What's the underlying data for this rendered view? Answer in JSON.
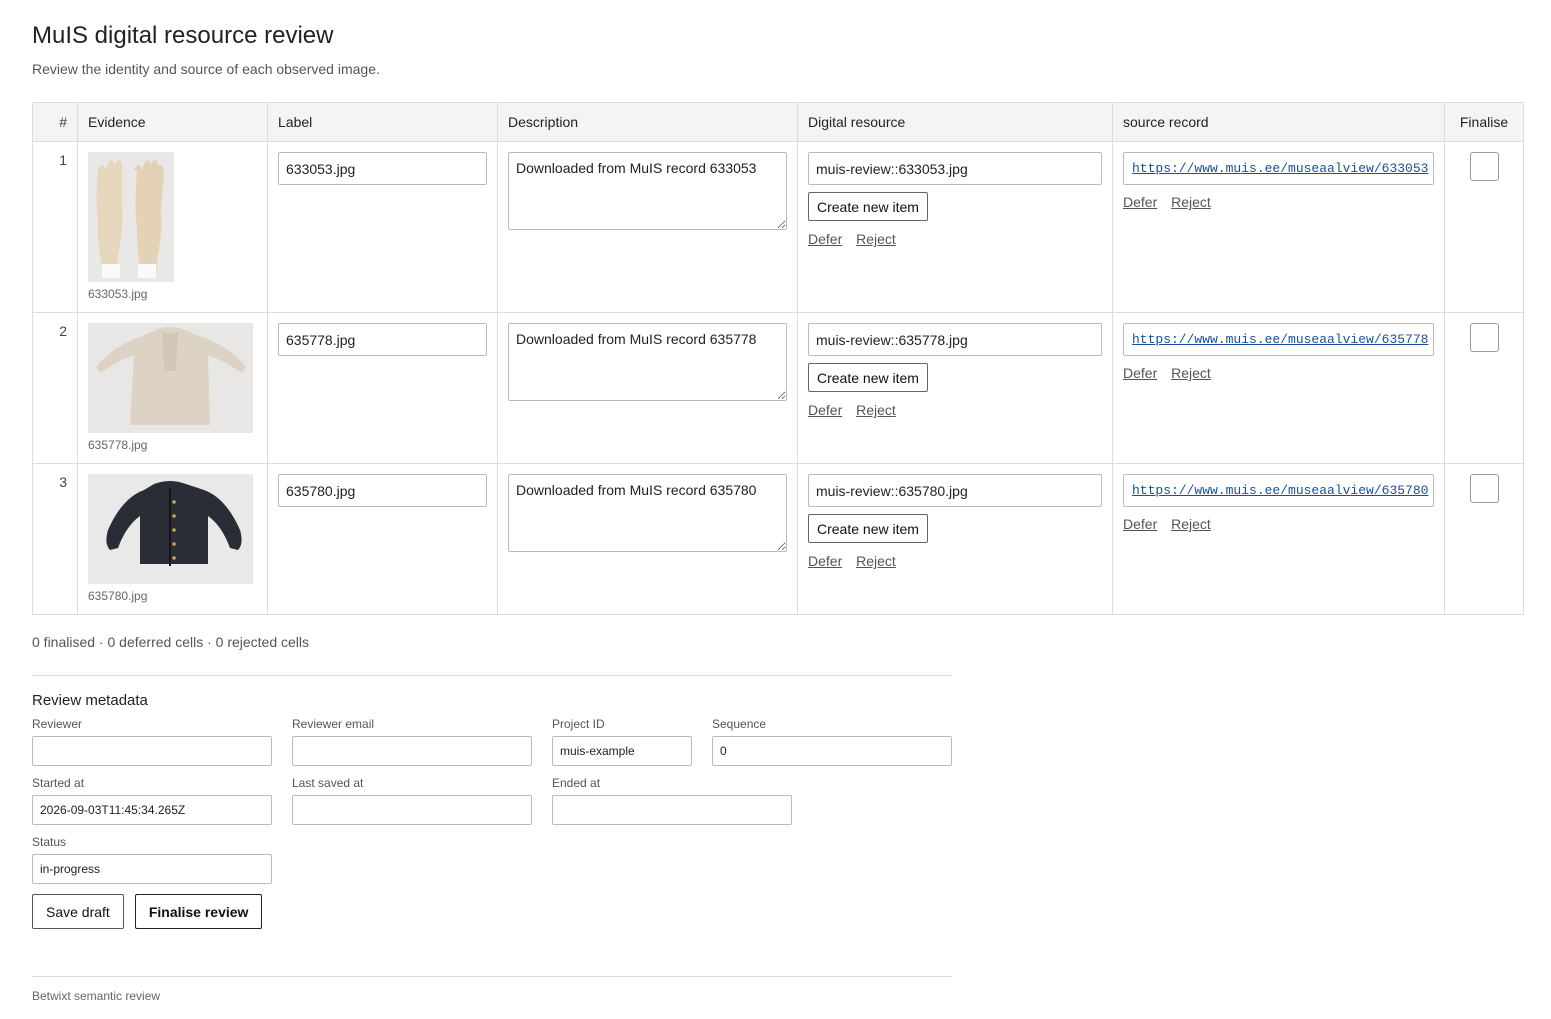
{
  "page": {
    "title": "MuIS digital resource review",
    "subtitle": "Review the identity and source of each observed image."
  },
  "table": {
    "headers": {
      "num": "#",
      "evidence": "Evidence",
      "label": "Label",
      "description": "Description",
      "digital_resource": "Digital resource",
      "source_record": "source record",
      "finalise": "Finalise"
    },
    "rows": [
      {
        "num": "1",
        "thumb_icon": "gloves-photo",
        "caption": "633053.jpg",
        "label": "633053.jpg",
        "description": "Downloaded from MuIS record 633053",
        "resource": "muis-review::633053.jpg",
        "create_label": "Create new item",
        "defer": "Defer",
        "reject": "Reject",
        "source_url": "https://www.muis.ee/museaalview/633053",
        "source_defer": "Defer",
        "source_reject": "Reject"
      },
      {
        "num": "2",
        "thumb_icon": "dress-photo",
        "caption": "635778.jpg",
        "label": "635778.jpg",
        "description": "Downloaded from MuIS record 635778",
        "resource": "muis-review::635778.jpg",
        "create_label": "Create new item",
        "defer": "Defer",
        "reject": "Reject",
        "source_url": "https://www.muis.ee/museaalview/635778",
        "source_defer": "Defer",
        "source_reject": "Reject"
      },
      {
        "num": "3",
        "thumb_icon": "jacket-photo",
        "caption": "635780.jpg",
        "label": "635780.jpg",
        "description": "Downloaded from MuIS record 635780",
        "resource": "muis-review::635780.jpg",
        "create_label": "Create new item",
        "defer": "Defer",
        "reject": "Reject",
        "source_url": "https://www.muis.ee/museaalview/635780",
        "source_defer": "Defer",
        "source_reject": "Reject"
      }
    ]
  },
  "summary": "0 finalised · 0 deferred cells · 0 rejected cells",
  "metadata": {
    "heading": "Review metadata",
    "reviewer": {
      "label": "Reviewer",
      "value": ""
    },
    "reviewer_email": {
      "label": "Reviewer email",
      "value": ""
    },
    "project_id": {
      "label": "Project ID",
      "value": "muis-example"
    },
    "sequence": {
      "label": "Sequence",
      "value": "0"
    },
    "started_at": {
      "label": "Started at",
      "value": "2026-09-03T11:45:34.265Z"
    },
    "last_saved_at": {
      "label": "Last saved at",
      "value": ""
    },
    "ended_at": {
      "label": "Ended at",
      "value": ""
    },
    "status": {
      "label": "Status",
      "value": "in-progress"
    }
  },
  "buttons": {
    "save_draft": "Save draft",
    "finalise_review": "Finalise review"
  },
  "footer": "Betwixt semantic review",
  "colors": {
    "link": "#1a4f9c",
    "header_bg": "#f4f4f4",
    "border": "#dddddd"
  }
}
